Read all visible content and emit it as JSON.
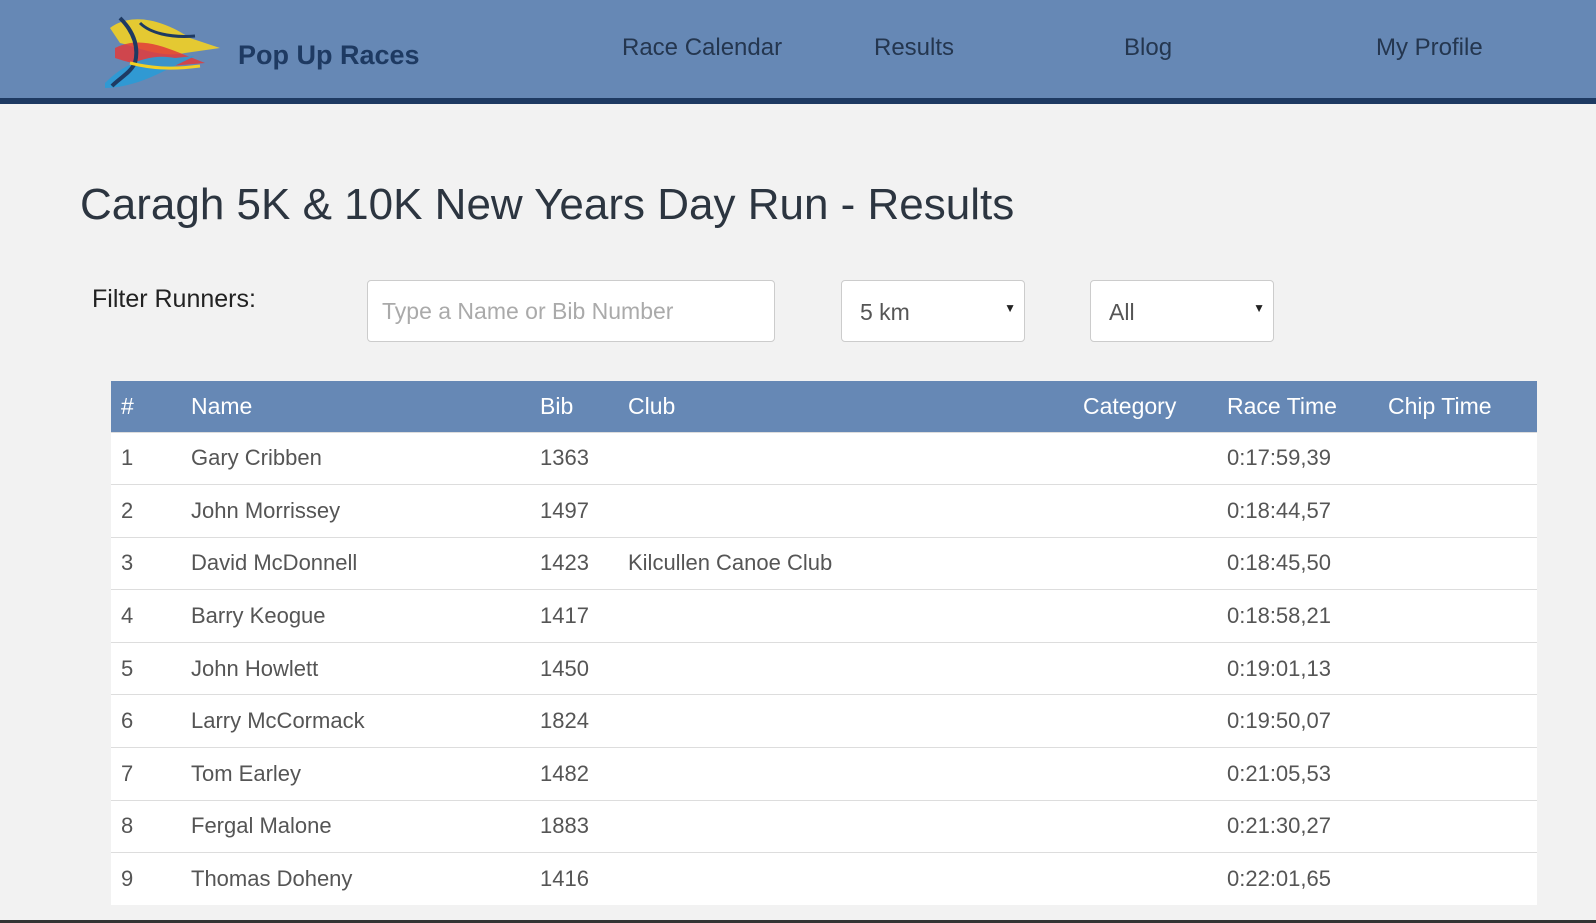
{
  "brand": {
    "name": "Pop Up Races"
  },
  "nav": {
    "items": [
      {
        "label": "Race Calendar"
      },
      {
        "label": "Results"
      },
      {
        "label": "Blog"
      },
      {
        "label": "My Profile"
      }
    ]
  },
  "page": {
    "title": "Caragh 5K & 10K New Years Day Run - Results"
  },
  "filter": {
    "label": "Filter Runners:",
    "search_placeholder": "Type a Name or Bib Number",
    "search_value": "",
    "distance_selected": "5 km",
    "category_selected": "All"
  },
  "table": {
    "headers": {
      "rank": "#",
      "name": "Name",
      "bib": "Bib",
      "club": "Club",
      "category": "Category",
      "race_time": "Race Time",
      "chip_time": "Chip Time"
    },
    "rows": [
      {
        "rank": "1",
        "name": "Gary Cribben",
        "bib": "1363",
        "club": "",
        "category": "",
        "race_time": "0:17:59,39",
        "chip_time": ""
      },
      {
        "rank": "2",
        "name": "John Morrissey",
        "bib": "1497",
        "club": "",
        "category": "",
        "race_time": "0:18:44,57",
        "chip_time": ""
      },
      {
        "rank": "3",
        "name": "David McDonnell",
        "bib": "1423",
        "club": "Kilcullen Canoe Club",
        "category": "",
        "race_time": "0:18:45,50",
        "chip_time": ""
      },
      {
        "rank": "4",
        "name": "Barry Keogue",
        "bib": "1417",
        "club": "",
        "category": "",
        "race_time": "0:18:58,21",
        "chip_time": ""
      },
      {
        "rank": "5",
        "name": "John Howlett",
        "bib": "1450",
        "club": "",
        "category": "",
        "race_time": "0:19:01,13",
        "chip_time": ""
      },
      {
        "rank": "6",
        "name": "Larry McCormack",
        "bib": "1824",
        "club": "",
        "category": "",
        "race_time": "0:19:50,07",
        "chip_time": ""
      },
      {
        "rank": "7",
        "name": "Tom Earley",
        "bib": "1482",
        "club": "",
        "category": "",
        "race_time": "0:21:05,53",
        "chip_time": ""
      },
      {
        "rank": "8",
        "name": "Fergal Malone",
        "bib": "1883",
        "club": "",
        "category": "",
        "race_time": "0:21:30,27",
        "chip_time": ""
      },
      {
        "rank": "9",
        "name": "Thomas Doheny",
        "bib": "1416",
        "club": "",
        "category": "",
        "race_time": "0:22:01,65",
        "chip_time": ""
      }
    ]
  },
  "colors": {
    "navbar": "#6688b5",
    "navbar_border": "#1e3a62",
    "table_header": "#6688b5",
    "page_background": "#f2f2f2"
  }
}
